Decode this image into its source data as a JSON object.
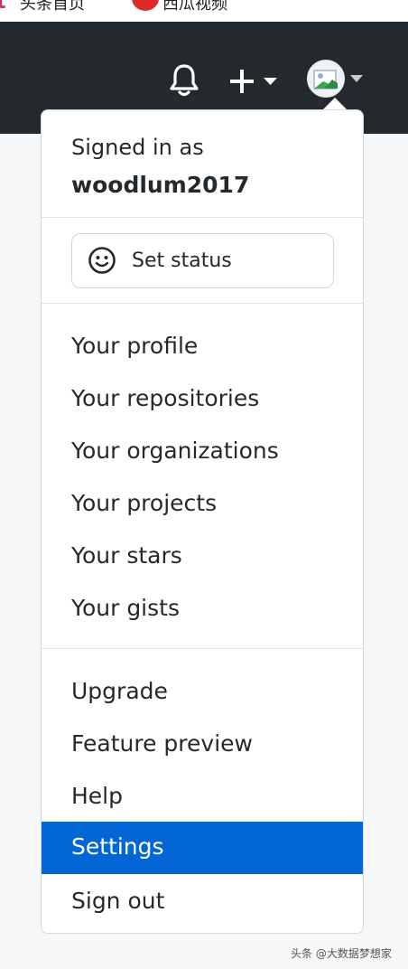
{
  "browser_strip": {
    "logo": "t",
    "tab1": "头条首页",
    "tab2": "西瓜视频"
  },
  "header": {
    "bell_icon": "bell-icon",
    "new_icon": "plus-icon",
    "avatar_icon": "avatar-image"
  },
  "menu": {
    "signed_in_label": "Signed in as",
    "username": "woodlum2017",
    "set_status": "Set status",
    "group1": [
      "Your profile",
      "Your repositories",
      "Your organizations",
      "Your projects",
      "Your stars",
      "Your gists"
    ],
    "group2": [
      "Upgrade",
      "Feature preview",
      "Help",
      "Settings",
      "Sign out"
    ],
    "active_item": "Settings"
  },
  "colors": {
    "header_bg": "#24292e",
    "active_bg": "#0366d6",
    "text": "#24292e"
  },
  "watermark": "头条 @大数据梦想家"
}
